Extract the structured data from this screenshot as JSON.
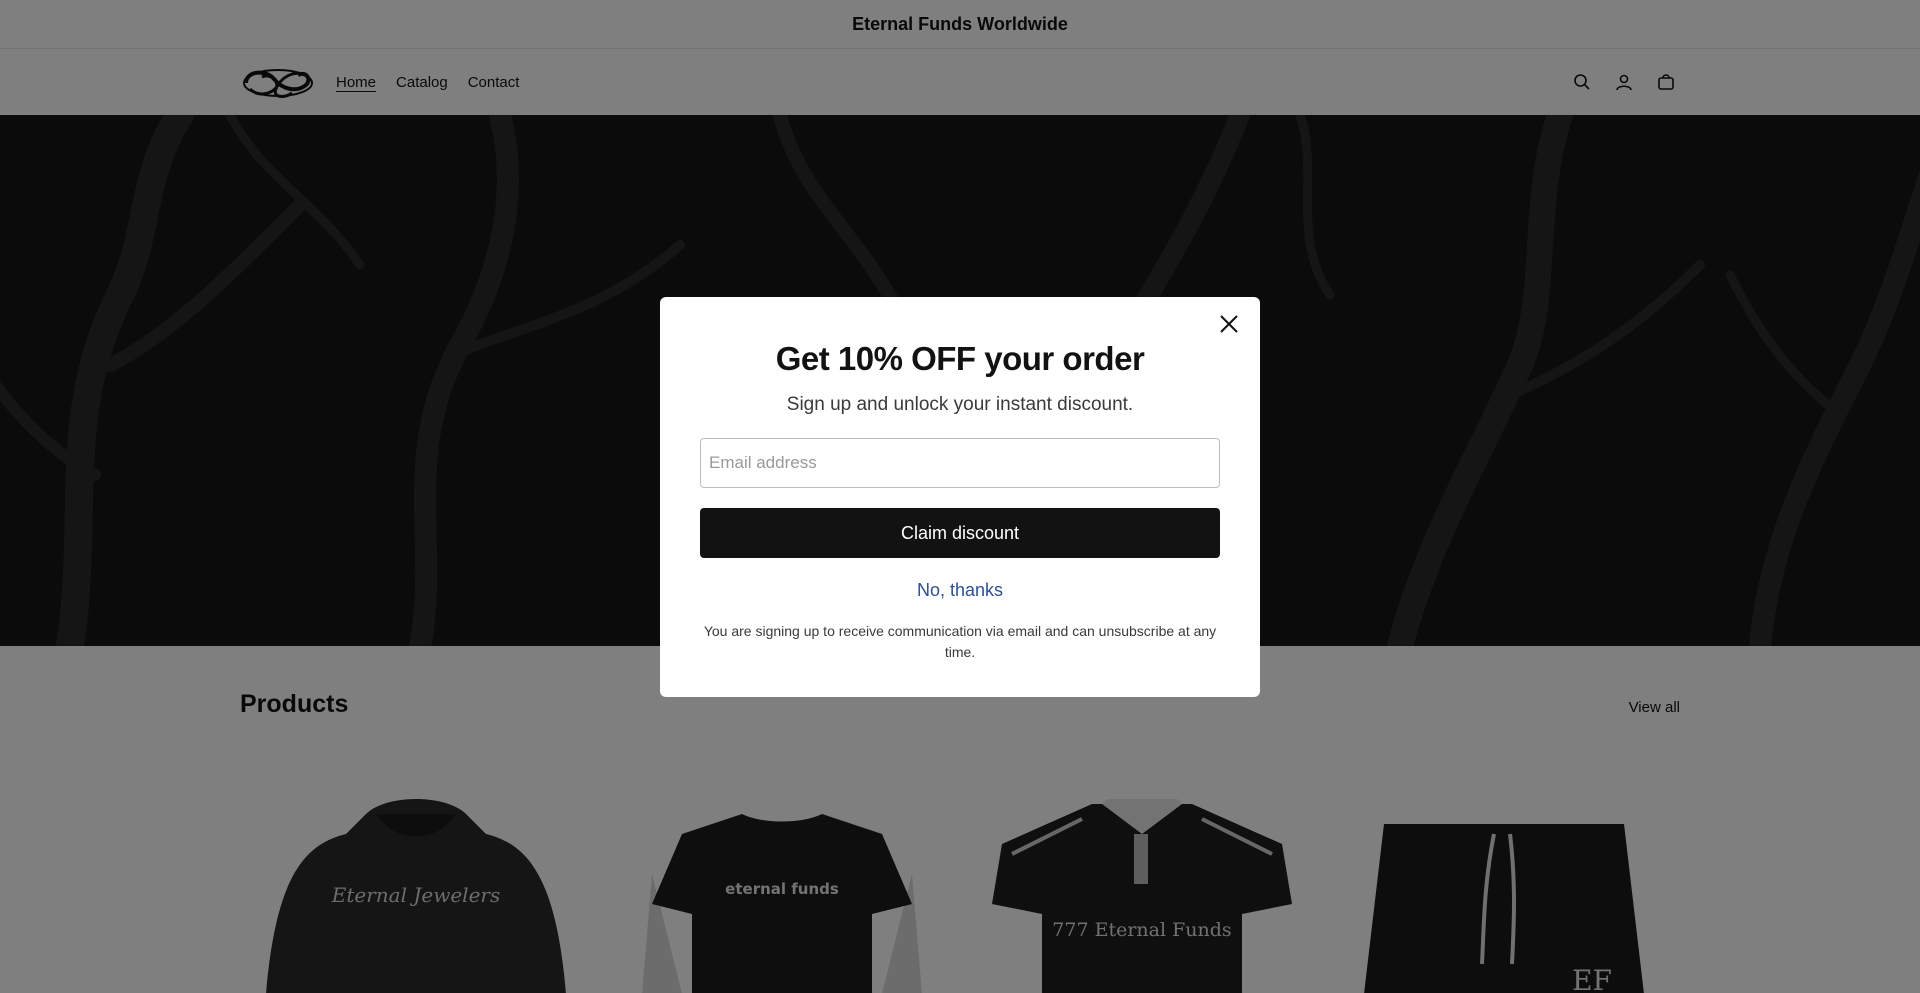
{
  "announcement": {
    "text": "Eternal Funds Worldwide"
  },
  "header": {
    "nav": [
      {
        "label": "Home"
      },
      {
        "label": "Catalog"
      },
      {
        "label": "Contact"
      }
    ],
    "icons": [
      "search-icon",
      "account-icon",
      "cart-icon"
    ]
  },
  "products": {
    "title": "Products",
    "view_all": "View all",
    "items": [
      {
        "print": "Eternal Jewelers"
      },
      {
        "print": "eternal funds"
      },
      {
        "print": "777 Eternal Funds"
      },
      {
        "print": "EF"
      }
    ]
  },
  "popup": {
    "title": "Get 10% OFF your order",
    "subtitle": "Sign up and unlock your instant discount.",
    "email_placeholder": "Email address",
    "email_value": "",
    "claim_label": "Claim discount",
    "decline_label": "No, thanks",
    "disclaimer": "You are signing up to receive communication via email and can unsubscribe at any time."
  },
  "colors": {
    "overlay": "rgba(0,0,0,0.5)",
    "button_bg": "#121212",
    "link": "#2a4f9c"
  }
}
